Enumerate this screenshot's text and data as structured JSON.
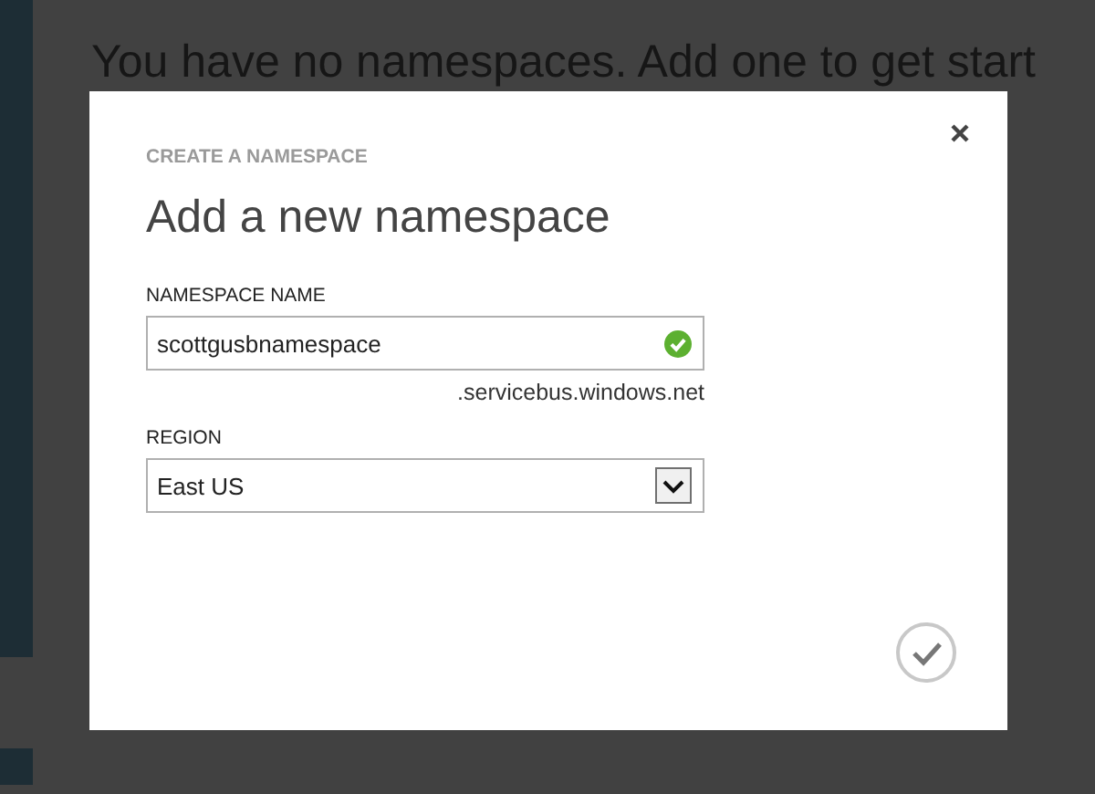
{
  "background": {
    "message": "You have no namespaces. Add one to get start"
  },
  "dialog": {
    "subtitle": "CREATE A NAMESPACE",
    "title": "Add a new namespace",
    "fields": [
      {
        "kind": "text",
        "label": "NAMESPACE NAME",
        "value": "scottgusbnamespace",
        "valid": true,
        "suffix": ".servicebus.windows.net"
      },
      {
        "kind": "select",
        "label": "REGION",
        "value": "East US"
      }
    ]
  }
}
